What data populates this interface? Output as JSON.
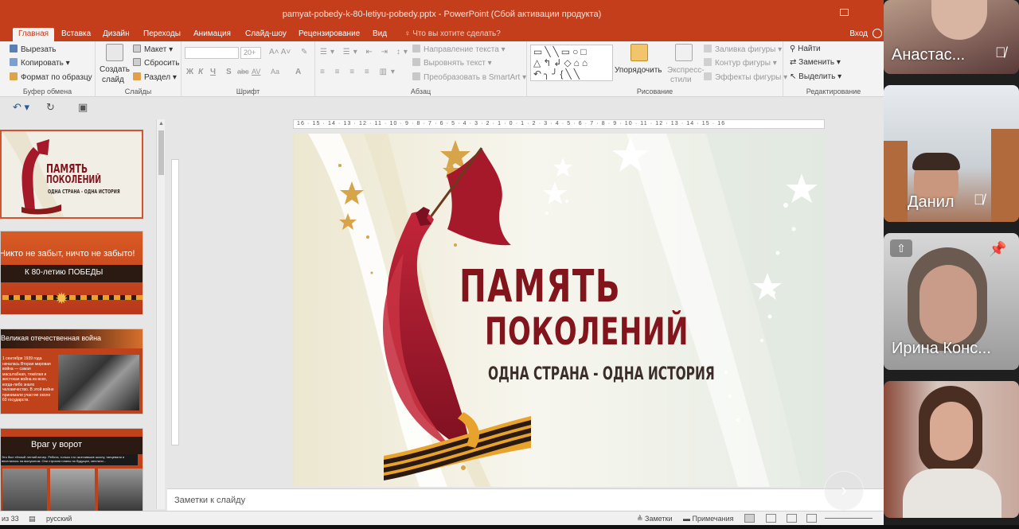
{
  "window": {
    "title": "pamyat-pobedy-k-80-letiyu-pobedy.pptx - PowerPoint (Сбой активации продукта)"
  },
  "tabs": [
    {
      "label": "Главная",
      "active": true
    },
    {
      "label": "Вставка"
    },
    {
      "label": "Дизайн"
    },
    {
      "label": "Переходы"
    },
    {
      "label": "Анимация"
    },
    {
      "label": "Слайд-шоу"
    },
    {
      "label": "Рецензирование"
    },
    {
      "label": "Вид"
    }
  ],
  "tell_me": "Что вы хотите сделать?",
  "login": "Вход",
  "ribbon": {
    "clipboard": {
      "cut": "Вырезать",
      "copy": "Копировать",
      "format_painter": "Формат по образцу",
      "label": "Буфер обмена"
    },
    "slides": {
      "new_slide_1": "Создать",
      "new_slide_2": "слайд",
      "layout": "Макет",
      "reset": "Сбросить",
      "section": "Раздел",
      "label": "Слайды"
    },
    "font": {
      "size": "20+",
      "bold": "Ж",
      "italic": "К",
      "underline": "Ч",
      "shadow": "S",
      "strike": "abc",
      "spacing": "AV",
      "case": "Aa",
      "label": "Шрифт"
    },
    "paragraph": {
      "text_direction": "Направление текста",
      "align_text": "Выровнять текст",
      "smartart": "Преобразовать в SmartArt",
      "label": "Абзац"
    },
    "drawing": {
      "arrange": "Упорядочить",
      "quick_styles_1": "Экспресс-",
      "quick_styles_2": "стили",
      "fill": "Заливка фигуры",
      "outline": "Контур фигуры",
      "effects": "Эффекты фигуры",
      "label": "Рисование"
    },
    "editing": {
      "find": "Найти",
      "replace": "Заменить",
      "select": "Выделить",
      "label": "Редактирование"
    }
  },
  "ruler_text": "16 · 15 · 14 · 13 · 12 · 11 · 10 · 9 · 8 · 7 · 6 · 5 · 4 · 3 · 2 · 1 · 0 · 1 · 2 · 3 · 4 · 5 · 6 · 7 · 8 · 9 · 10 · 11 · 12 · 13 · 14 · 15 · 16",
  "slide": {
    "title_line1": "ПАМЯТЬ",
    "title_line2": "ПОКОЛЕНИЙ",
    "subtitle": "ОДНА СТРАНА - ОДНА ИСТОРИЯ"
  },
  "thumbnails": [
    {
      "title1": "ПАМЯТЬ",
      "title2": "ПОКОЛЕНИЙ",
      "subtitle": "ОДНА СТРАНА - ОДНА ИСТОРИЯ"
    },
    {
      "line1": "Никто не забыт, ничто не забыто!",
      "line2": "К 80-летию ПОБЕДЫ"
    },
    {
      "heading": "Великая отечественная война",
      "body": "1 сентября 1939 года началась Вторая мировая война — самая масштабная, тяжёлая и жестокая война из всех, когда-либо знало человечество. В этой войне принимали участие около 60 государств."
    },
    {
      "heading": "Враг у ворот",
      "body": "Это был тёплый летний вечер. Ребята, только что окончившие школу, танцевали и веселились на выпускном. Они строили планы на будущее, мечтали..."
    }
  ],
  "notes_placeholder": "Заметки к слайду",
  "status": {
    "slide_count": "из 33",
    "language": "русский",
    "notes": "Заметки",
    "comments": "Примечания"
  },
  "participants": [
    {
      "name": "Анастас...",
      "muted": true
    },
    {
      "name": "Данил",
      "muted": true
    },
    {
      "name": "Ирина Конс...",
      "muted": false,
      "pinned": true
    },
    {
      "name": "",
      "muted": false
    }
  ],
  "colors": {
    "ppt_red": "#c43e1c",
    "flag_red": "#a5192a",
    "title_red": "#82141c",
    "star_gold": "#d7a44a"
  }
}
